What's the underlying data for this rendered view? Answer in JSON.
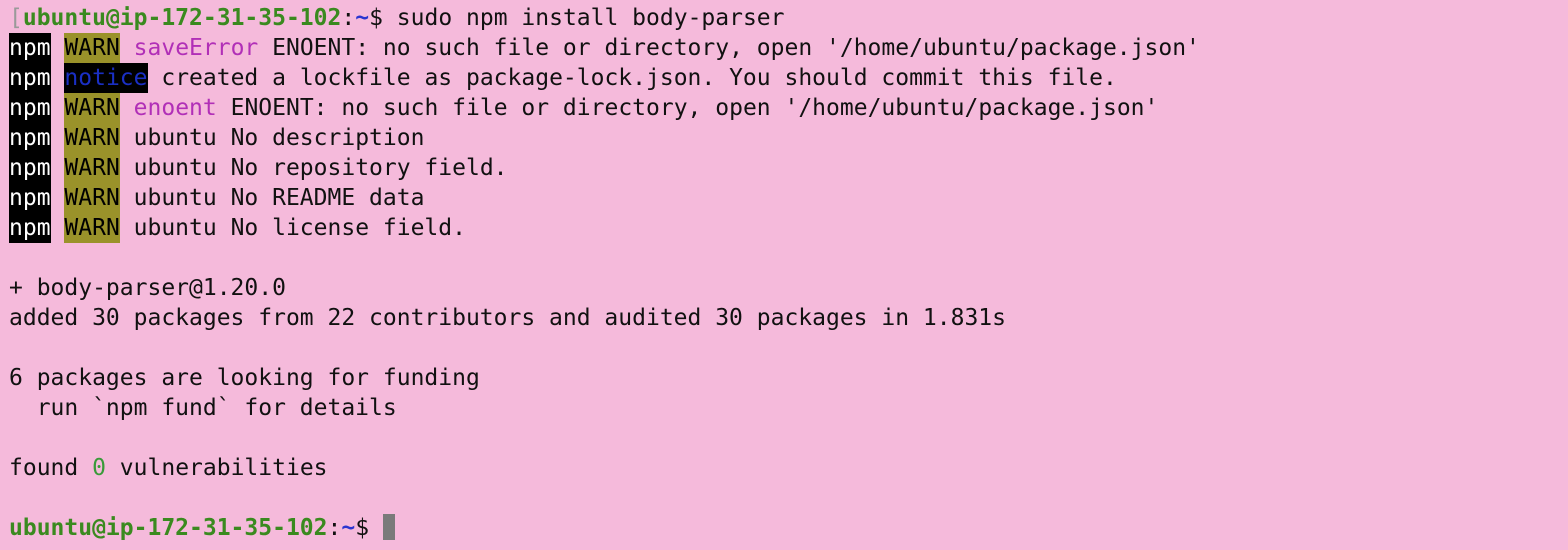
{
  "prompt": {
    "user_host": "ubuntu@ip-172-31-35-102",
    "sep": ":",
    "path": "~",
    "symbol": "$ ",
    "left_bracket": "["
  },
  "command": "sudo npm install body-parser",
  "npm_lines": [
    {
      "npm": "npm",
      "level": "WARN",
      "kind": "saveError",
      "message": " ENOENT: no such file or directory, open '/home/ubuntu/package.json'"
    },
    {
      "npm": "npm",
      "level": "notice",
      "message": " created a lockfile as package-lock.json. You should commit this file."
    },
    {
      "npm": "npm",
      "level": "WARN",
      "kind": "enoent",
      "message": " ENOENT: no such file or directory, open '/home/ubuntu/package.json'"
    },
    {
      "npm": "npm",
      "level": "WARN",
      "message": " ubuntu No description"
    },
    {
      "npm": "npm",
      "level": "WARN",
      "message": " ubuntu No repository field."
    },
    {
      "npm": "npm",
      "level": "WARN",
      "message": " ubuntu No README data"
    },
    {
      "npm": "npm",
      "level": "WARN",
      "message": " ubuntu No license field."
    }
  ],
  "install_summary": {
    "package_line": "+ body-parser@1.20.0",
    "added_line": "added 30 packages from 22 contributors and audited 30 packages in 1.831s"
  },
  "funding": {
    "line1": "6 packages are looking for funding",
    "line2": "  run `npm fund` for details"
  },
  "vulnerabilities": {
    "prefix": "found ",
    "count": "0",
    "suffix": " vulnerabilities"
  },
  "colors": {
    "background": "#f5badb",
    "prompt_user": "#3a8a1f",
    "prompt_path": "#2a35d0",
    "warn_bg": "#9a922a",
    "npm_bg": "#000000",
    "magenta": "#b12fb7"
  }
}
